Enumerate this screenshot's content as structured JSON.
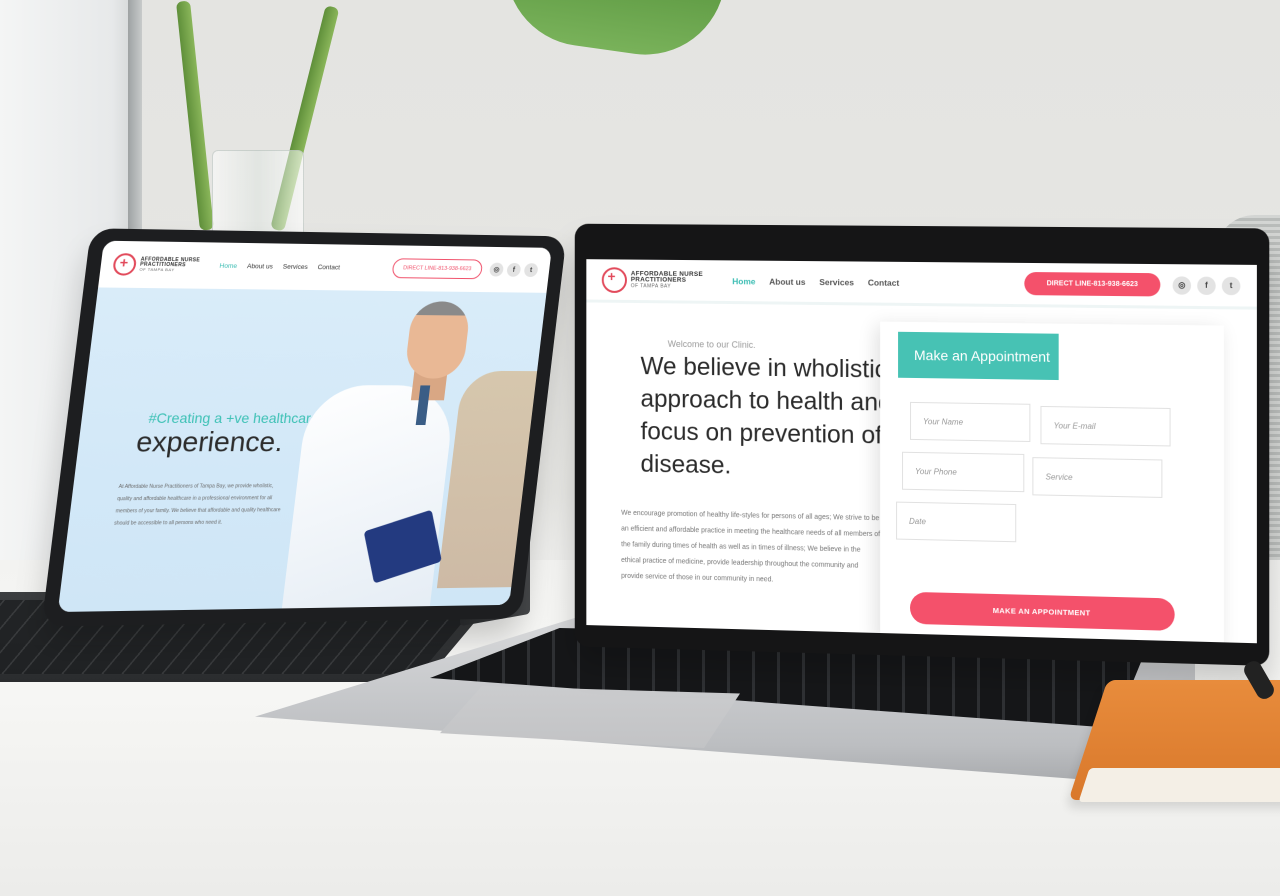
{
  "brand": {
    "line1": "AFFORDABLE NURSE",
    "line2": "PRACTITIONERS",
    "line3": "OF TAMPA BAY"
  },
  "nav": {
    "items": [
      "Home",
      "About us",
      "Services",
      "Contact"
    ],
    "cta": "DIRECT LINE-813-938-6623"
  },
  "social": [
    "instagram-icon",
    "facebook-icon",
    "twitter-icon"
  ],
  "tablet_hero": {
    "tag": "#Creating a +ve healthcare",
    "title": "experience.",
    "body": "At Affordable Nurse Practitioners of Tampa Bay, we provide wholistic, quality and affordable healthcare in a professional environment for all members of your family. We believe that affordable and quality healthcare should be accessible to all persons who need it."
  },
  "laptop_intro": {
    "welcome": "Welcome to our Clinic.",
    "headline": "We believe in wholistic approach to health and focus on prevention of disease.",
    "body": "We encourage promotion of healthy life-styles for persons of all ages; We strive to be an efficient and affordable practice in meeting the healthcare needs of all members of the family during times of health as well as in times of illness; We believe in the ethical practice of medicine, provide leadership throughout the community and provide service of those in our community in need."
  },
  "appointment": {
    "title": "Make an Appointment",
    "name_placeholder": "Your Name",
    "email_placeholder": "Your E-mail",
    "phone_placeholder": "Your Phone",
    "service_placeholder": "Service",
    "date_placeholder": "Date",
    "submit": "MAKE AN APPOINTMENT"
  },
  "colors": {
    "teal": "#47c2b4",
    "pink": "#f4516b"
  }
}
